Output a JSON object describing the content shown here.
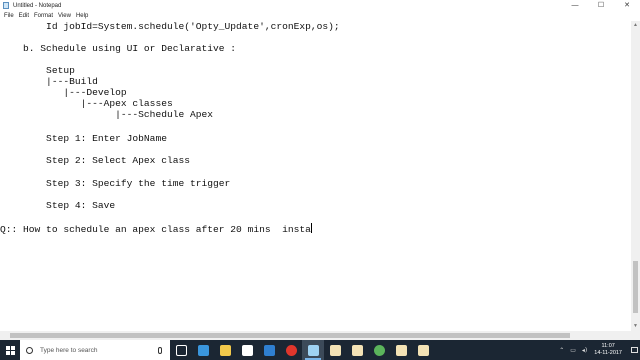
{
  "window": {
    "title": "Untitled - Notepad",
    "controls": {
      "minimize": "—",
      "maximize": "☐",
      "close": "✕"
    }
  },
  "menu": {
    "items": [
      "File",
      "Edit",
      "Format",
      "View",
      "Help"
    ]
  },
  "editor": {
    "lines": [
      "        Id jobId=System.schedule('Opty_Update',cronExp,os);",
      "",
      "    b. Schedule using UI or Declarative :",
      "",
      "        Setup",
      "        |---Build",
      "           |---Develop",
      "              |---Apex classes",
      "                    |---Schedule Apex",
      "",
      "        Step 1: Enter JobName",
      "",
      "        Step 2: Select Apex class",
      "",
      "        Step 3: Specify the time trigger",
      "",
      "        Step 4: Save",
      "",
      "Q:: How to schedule an apex class after 20 mins  insta"
    ]
  },
  "taskbar": {
    "search_placeholder": "Type here to search",
    "apps": [
      {
        "name": "task-view",
        "color": "#ffffff"
      },
      {
        "name": "edge",
        "color": "#3a96dd"
      },
      {
        "name": "file-explorer",
        "color": "#f2c94c"
      },
      {
        "name": "store",
        "color": "#ffffff"
      },
      {
        "name": "mail",
        "color": "#2f7fd1"
      },
      {
        "name": "opera",
        "color": "#e0362c"
      },
      {
        "name": "notepad",
        "color": "#9fd3f3"
      },
      {
        "name": "app-1",
        "color": "#f3e2b5"
      },
      {
        "name": "app-2",
        "color": "#f3e2b5"
      },
      {
        "name": "chrome",
        "color": "#5bb45b"
      },
      {
        "name": "app-3",
        "color": "#f3e2b5"
      },
      {
        "name": "app-4",
        "color": "#f3e2b5"
      }
    ],
    "clock_time": "11:07",
    "clock_date": "14-11-2017"
  }
}
